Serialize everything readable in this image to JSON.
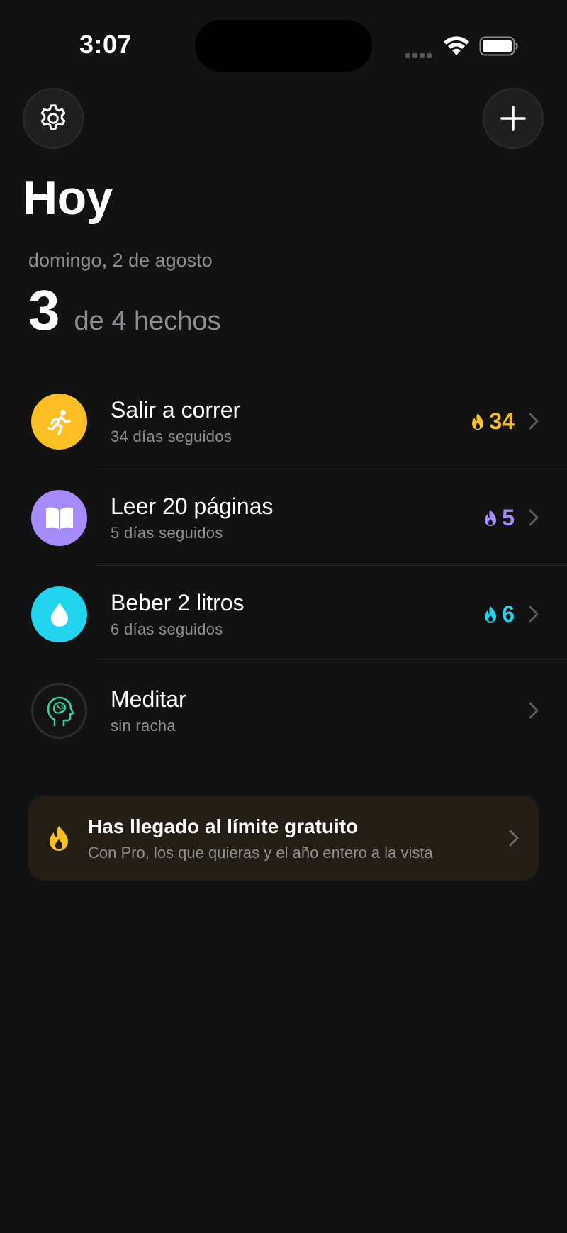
{
  "status_bar": {
    "time": "3:07"
  },
  "header": {
    "settings_icon": "gear-icon",
    "add_icon": "plus-icon",
    "title": "Hoy"
  },
  "summary": {
    "date": "domingo, 2 de agosto",
    "done_count": "3",
    "done_label": "de 4 hechos"
  },
  "habits": [
    {
      "name": "Salir a correr",
      "subtitle": "34 días seguidos",
      "streak": "34",
      "icon": "running-icon",
      "color": "#fbbf24"
    },
    {
      "name": "Leer 20 páginas",
      "subtitle": "5 días seguidos",
      "streak": "5",
      "icon": "book-icon",
      "color": "#a78bfa"
    },
    {
      "name": "Beber 2 litros",
      "subtitle": "6 días seguidos",
      "streak": "6",
      "icon": "water-drop-icon",
      "color": "#22d3ee"
    },
    {
      "name": "Meditar",
      "subtitle": "sin racha",
      "streak": "",
      "icon": "brain-head-icon",
      "color": "#34d399"
    }
  ],
  "promo": {
    "title": "Has llegado al límite gratuito",
    "subtitle": "Con Pro, los que quieras y el año entero a la vista",
    "icon": "flame-icon",
    "color": "#fbbf24"
  }
}
